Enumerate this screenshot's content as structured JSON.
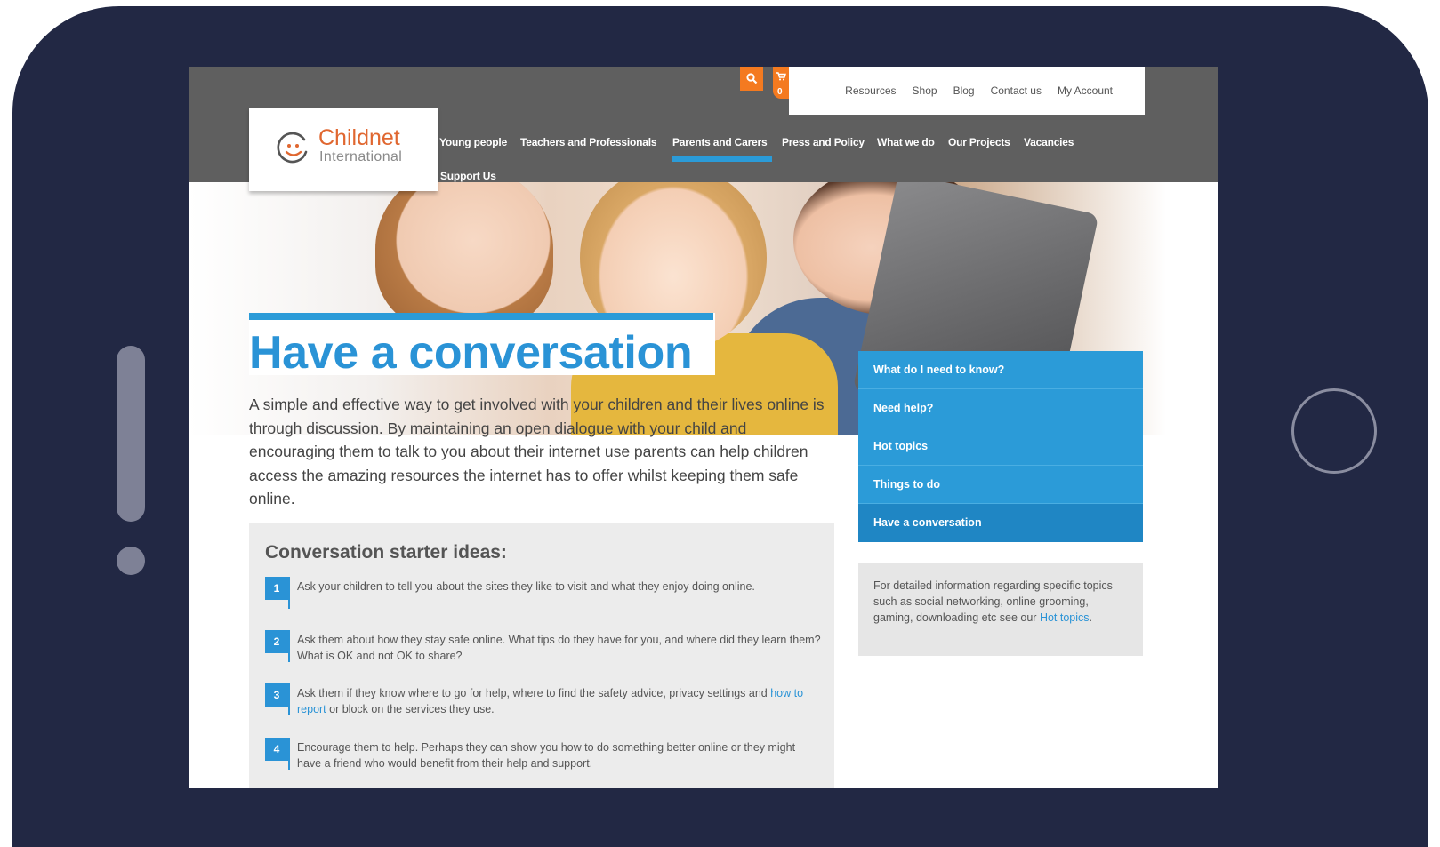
{
  "site": {
    "logo_name": "Childnet",
    "logo_sub": "International"
  },
  "top_links": [
    "Resources",
    "Shop",
    "Blog",
    "Contact us",
    "My Account"
  ],
  "cart_count": "0",
  "main_nav": [
    "Young people",
    "Teachers and Professionals",
    "Parents and Carers",
    "Press and Policy",
    "What we do",
    "Our Projects",
    "Vacancies",
    "Support Us"
  ],
  "active_nav": "Parents and Carers",
  "page_title": "Have a conversation",
  "intro": "A simple and effective way to get involved with your children and their lives online is through discussion.  By maintaining an open dialogue with your child and encouraging them to talk to you about their internet use parents can help children access the amazing resources the internet has to offer whilst keeping them safe online.",
  "starter": {
    "title": "Conversation starter ideas:",
    "steps": [
      {
        "num": "1",
        "text": "Ask your children to tell you about the sites they like to visit and what they enjoy doing online."
      },
      {
        "num": "2",
        "text": "Ask them about how they stay safe online. What tips do they have for you, and where did they learn them? What is OK and not OK to share?"
      },
      {
        "num": "3",
        "text_before": "Ask them if they know where to go for help, where to find the safety advice, privacy settings and ",
        "link": "how to report",
        "text_after": " or block on the services they use."
      },
      {
        "num": "4",
        "text": "Encourage them to help. Perhaps they can show you how to do something better online or they might have a friend who would benefit from their help and support."
      }
    ]
  },
  "side_nav": [
    "What do I need to know?",
    "Need help?",
    "Hot topics",
    "Things to do",
    "Have a conversation"
  ],
  "side_active": "Have a conversation",
  "info": {
    "text_before": "For detailed information regarding specific topics such as social networking, online grooming, gaming, downloading etc see our ",
    "link": "Hot topics",
    "text_after": "."
  },
  "colors": {
    "accent_blue": "#2b9bd8",
    "accent_orange": "#f47a20",
    "device_frame": "#222844"
  },
  "icons": [
    "search-icon",
    "cart-icon",
    "logo-smiley-icon"
  ]
}
